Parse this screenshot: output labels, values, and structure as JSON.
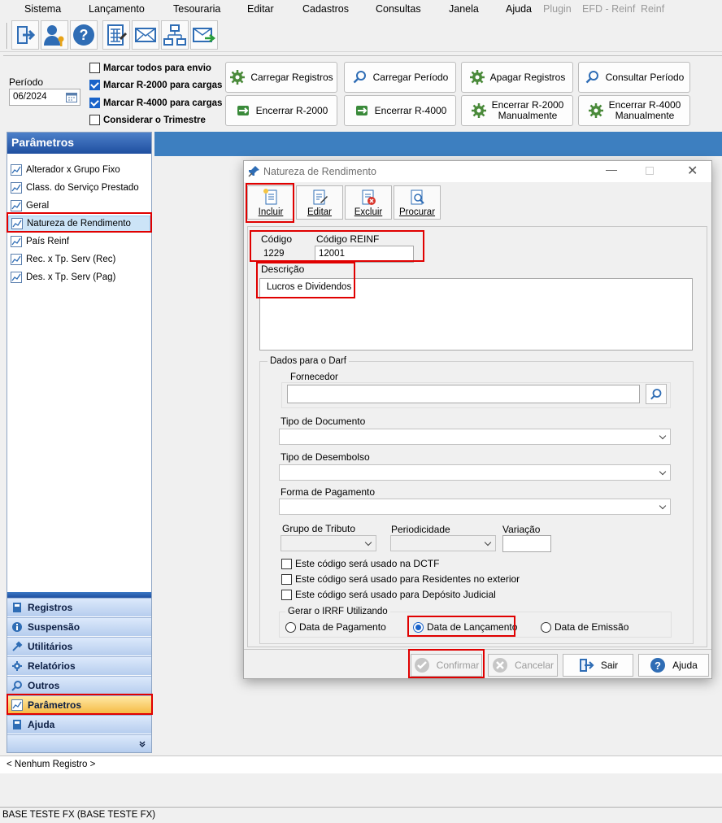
{
  "menubar": [
    "Sistema",
    "Lançamento",
    "Tesouraria",
    "Editar",
    "Cadastros",
    "Consultas",
    "Janela",
    "Ajuda",
    "Plugin",
    "EFD - Reinf",
    "Reinf"
  ],
  "toolbar": {
    "icons": [
      "exit-icon",
      "user-key-icon",
      "help-icon",
      "calculator-icon",
      "mail-icon",
      "network-icon",
      "mail-send-icon"
    ]
  },
  "filters": {
    "periodo_label": "Período",
    "periodo_value": "06/2024",
    "marcar_todos": "Marcar todos para envio",
    "marcar_r2000": "Marcar R-2000 para cargas",
    "marcar_r4000": "Marcar R-4000 para cargas",
    "considerar_trimestre": "Considerar o Trimestre",
    "marcar_todos_checked": false,
    "marcar_r2000_checked": true,
    "marcar_r4000_checked": true,
    "considerar_trimestre_checked": false
  },
  "actions": {
    "carregar_registros": "Carregar Registros",
    "carregar_periodo": "Carregar Período",
    "apagar_registros": "Apagar Registros",
    "consultar_periodo": "Consultar Período",
    "encerrar_r2000": "Encerrar R-2000",
    "encerrar_r4000": "Encerrar R-4000",
    "encerrar_r2000_manual_1": "Encerrar R-2000",
    "encerrar_r2000_manual_2": "Manualmente",
    "encerrar_r4000_manual_1": "Encerrar R-4000",
    "encerrar_r4000_manual_2": "Manualmente"
  },
  "sidebar": {
    "title": "Parâmetros",
    "items": [
      "Alterador x Grupo Fixo",
      "Class. do Serviço Prestado",
      "Geral",
      "Natureza de Rendimento",
      "País Reinf",
      "Rec. x Tp. Serv (Rec)",
      "Des. x Tp. Serv (Pag)"
    ],
    "sections": [
      "Registros",
      "Suspensão",
      "Utilitários",
      "Relatórios",
      "Outros",
      "Parâmetros",
      "Ajuda"
    ]
  },
  "status": {
    "record": "< Nenhum Registro >",
    "base": "BASE TESTE FX (BASE TESTE FX)"
  },
  "dialog": {
    "title": "Natureza de Rendimento",
    "toolbar": {
      "incluir": "Incluir",
      "editar": "Editar",
      "excluir": "Excluir",
      "procurar": "Procurar"
    },
    "codigo_label": "Código",
    "codigo_value": "1229",
    "codigo_reinf_label": "Código REINF",
    "codigo_reinf_value": "12001",
    "descricao_label": "Descrição",
    "descricao_value": "Lucros e Dividendos",
    "darf_group": "Dados para o Darf",
    "fornecedor_label": "Fornecedor",
    "fornecedor_value": "",
    "tipo_documento_label": "Tipo de Documento",
    "tipo_desembolso_label": "Tipo de Desembolso",
    "forma_pagamento_label": "Forma de Pagamento",
    "grupo_tributo_label": "Grupo de Tributo",
    "periodicidade_label": "Periodicidade",
    "variacao_label": "Variação",
    "chk_dctf": "Este código será usado na DCTF",
    "chk_residentes": "Este código será usado para Residentes no exterior",
    "chk_deposito": "Este código será usado para Depósito Judicial",
    "irrf_group": "Gerar o IRRF Utilizando",
    "radio_pagamento": "Data de Pagamento",
    "radio_lancamento": "Data de Lançamento",
    "radio_emissao": "Data de Emissão",
    "radio_selected": "Data de Lançamento",
    "footer": {
      "confirmar": "Confirmar",
      "cancelar": "Cancelar",
      "sair": "Sair",
      "ajuda": "Ajuda"
    }
  },
  "colors": {
    "accent": "#1a63c9",
    "highlight_box": "#e00000",
    "header_blue": "#3d7fc0"
  }
}
